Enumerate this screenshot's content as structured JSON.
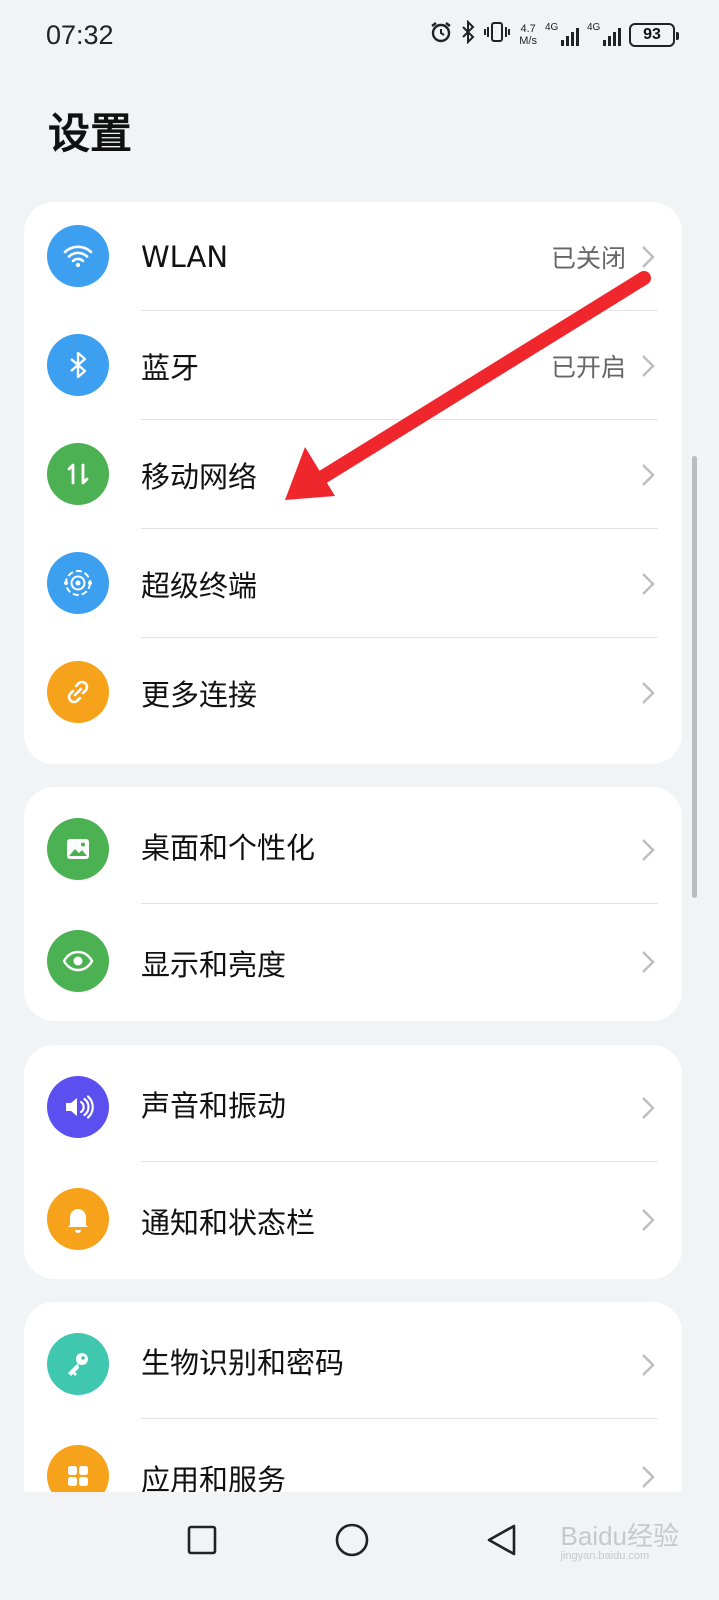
{
  "status_bar": {
    "time": "07:32",
    "net_speed_value": "4.7",
    "net_speed_unit": "M/s",
    "sim1_label": "4G",
    "sim2_label": "4G",
    "battery": "93"
  },
  "page": {
    "title": "设置"
  },
  "groups": [
    {
      "items": [
        {
          "label": "WLAN",
          "value": "已关闭",
          "icon": "wifi-icon",
          "color": "#3d9ff0"
        },
        {
          "label": "蓝牙",
          "value": "已开启",
          "icon": "bluetooth-icon",
          "color": "#3d9ff0"
        },
        {
          "label": "移动网络",
          "value": "",
          "icon": "mobile-data-icon",
          "color": "#4cb153"
        },
        {
          "label": "超级终端",
          "value": "",
          "icon": "super-device-icon",
          "color": "#3d9ff0"
        },
        {
          "label": "更多连接",
          "value": "",
          "icon": "link-icon",
          "color": "#f7a21b"
        }
      ]
    },
    {
      "items": [
        {
          "label": "桌面和个性化",
          "value": "",
          "icon": "picture-icon",
          "color": "#4cb153"
        },
        {
          "label": "显示和亮度",
          "value": "",
          "icon": "eye-icon",
          "color": "#4cb153"
        }
      ]
    },
    {
      "items": [
        {
          "label": "声音和振动",
          "value": "",
          "icon": "speaker-icon",
          "color": "#5b4ff0"
        },
        {
          "label": "通知和状态栏",
          "value": "",
          "icon": "bell-icon",
          "color": "#f7a21b"
        }
      ]
    },
    {
      "items": [
        {
          "label": "生物识别和密码",
          "value": "",
          "icon": "key-icon",
          "color": "#3fc7b0"
        },
        {
          "label": "应用和服务",
          "value": "",
          "icon": "apps-icon",
          "color": "#f7a21b"
        }
      ]
    }
  ],
  "annotation": {
    "arrow_color": "#f0262d"
  },
  "watermark": {
    "text": "Baidu经验",
    "subtext": "jingyan.baidu.com"
  }
}
